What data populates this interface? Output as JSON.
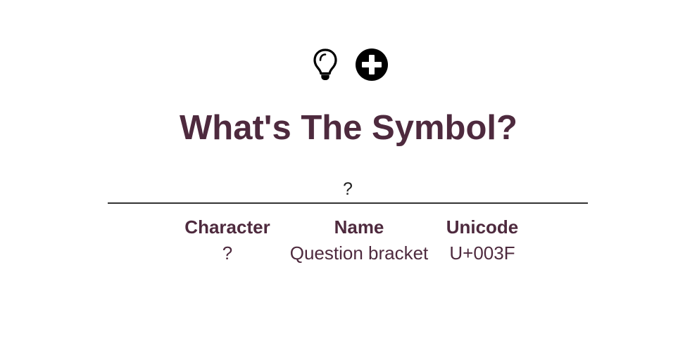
{
  "toolbar": {
    "hint_icon": "lightbulb-icon",
    "add_icon": "plus-circle-icon"
  },
  "page": {
    "title": "What's The Symbol?"
  },
  "search": {
    "value": "?"
  },
  "table": {
    "headers": {
      "character": "Character",
      "name": "Name",
      "unicode": "Unicode"
    },
    "rows": [
      {
        "character": "?",
        "name": "Question bracket",
        "unicode": "U+003F"
      }
    ]
  },
  "colors": {
    "accent": "#4e2a3e",
    "text": "#222222",
    "divider": "#333333"
  }
}
